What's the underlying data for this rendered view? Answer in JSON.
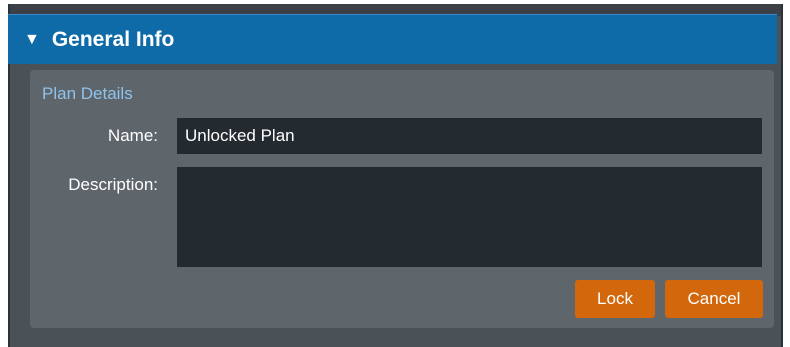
{
  "section": {
    "title": "General Info"
  },
  "panel": {
    "title": "Plan Details",
    "name_label": "Name:",
    "name_value": "Unlocked Plan",
    "description_label": "Description:",
    "description_value": ""
  },
  "buttons": {
    "lock_label": "Lock",
    "cancel_label": "Cancel"
  },
  "colors": {
    "header": "#0f6aa8",
    "panel": "#5e656b",
    "field": "#232a30",
    "accent_button": "#d2670b",
    "panel_title": "#8fc3ec"
  },
  "icons": {
    "collapse": "caret-down-icon"
  }
}
